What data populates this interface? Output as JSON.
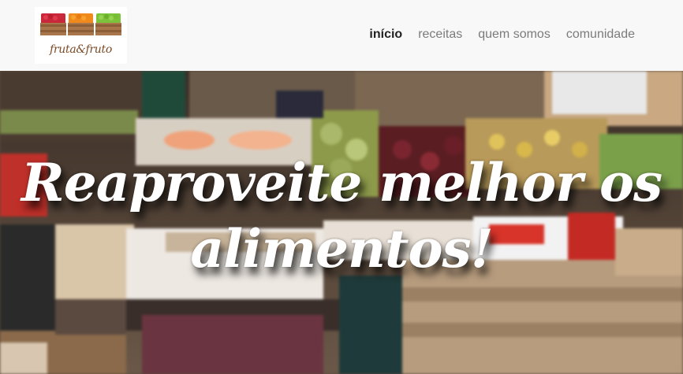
{
  "brand": {
    "logo_text": "fruta&fruto",
    "logo_icon": "fruit-crates-icon"
  },
  "nav": {
    "items": [
      {
        "label": "início",
        "active": true
      },
      {
        "label": "receitas",
        "active": false
      },
      {
        "label": "quem somos",
        "active": false
      },
      {
        "label": "comunidade",
        "active": false
      }
    ]
  },
  "hero": {
    "title_line1": "Reaproveite melhor os",
    "title_line2": "alimentos!",
    "background": "market-stall-photo"
  },
  "colors": {
    "navbar_bg": "#f8f8f8",
    "nav_active": "#222222",
    "nav_inactive": "#7b7b7b",
    "logo_text": "#7a4a26",
    "hero_text": "#ffffff"
  }
}
